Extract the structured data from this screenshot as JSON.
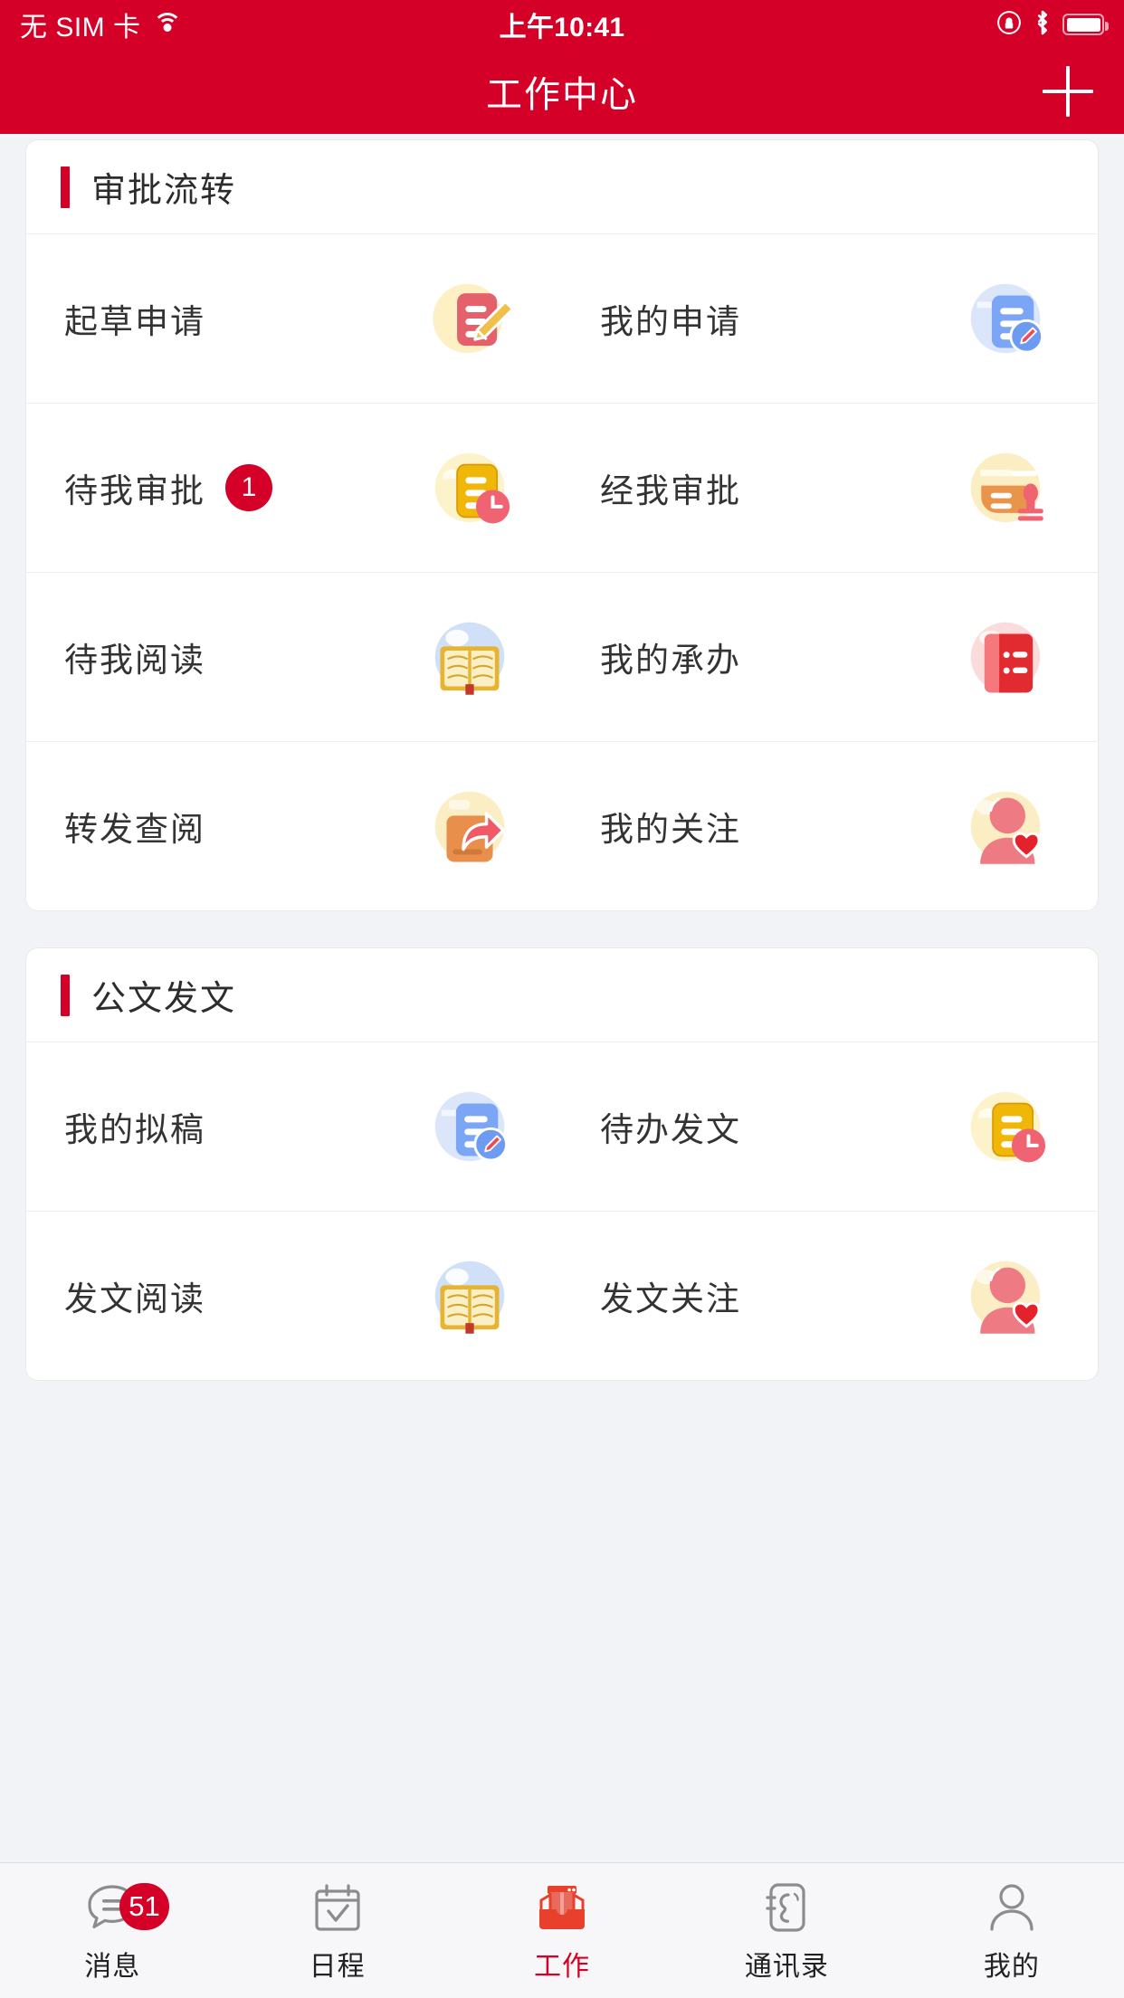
{
  "status_bar": {
    "carrier": "无 SIM 卡",
    "wifi_icon": "wifi-icon",
    "time": "上午10:41",
    "rotation_lock_icon": "rotation-lock-icon",
    "bluetooth_icon": "bluetooth-icon",
    "battery_icon": "battery-icon"
  },
  "nav_bar": {
    "title": "工作中心",
    "add_label": "+",
    "add_icon": "plus-icon",
    "background_color": "#d50028"
  },
  "sections": [
    {
      "title": "审批流转",
      "rows": [
        [
          {
            "label": "起草申请",
            "icon": "draft-application-icon",
            "badge": null
          },
          {
            "label": "我的申请",
            "icon": "my-application-icon",
            "badge": null
          }
        ],
        [
          {
            "label": "待我审批",
            "icon": "pending-approval-icon",
            "badge": "1"
          },
          {
            "label": "经我审批",
            "icon": "approved-by-me-icon",
            "badge": null
          }
        ],
        [
          {
            "label": "待我阅读",
            "icon": "pending-read-icon",
            "badge": null
          },
          {
            "label": "我的承办",
            "icon": "my-handling-icon",
            "badge": null
          }
        ],
        [
          {
            "label": "转发查阅",
            "icon": "forward-review-icon",
            "badge": null
          },
          {
            "label": "我的关注",
            "icon": "my-follow-icon",
            "badge": null
          }
        ]
      ]
    },
    {
      "title": "公文发文",
      "rows": [
        [
          {
            "label": "我的拟稿",
            "icon": "my-drafts-icon",
            "badge": null
          },
          {
            "label": "待办发文",
            "icon": "pending-dispatch-icon",
            "badge": null
          }
        ],
        [
          {
            "label": "发文阅读",
            "icon": "dispatch-read-icon",
            "badge": null
          },
          {
            "label": "发文关注",
            "icon": "dispatch-follow-icon",
            "badge": null
          }
        ]
      ]
    }
  ],
  "tab_bar": {
    "active_color": "#d50028",
    "items": [
      {
        "label": "消息",
        "icon": "chat-bubble-icon",
        "badge": "51",
        "active": false
      },
      {
        "label": "日程",
        "icon": "calendar-check-icon",
        "badge": null,
        "active": false
      },
      {
        "label": "工作",
        "icon": "work-inbox-icon",
        "badge": null,
        "active": true
      },
      {
        "label": "通讯录",
        "icon": "contacts-phone-icon",
        "badge": null,
        "active": false
      },
      {
        "label": "我的",
        "icon": "person-icon",
        "badge": null,
        "active": false
      }
    ]
  }
}
